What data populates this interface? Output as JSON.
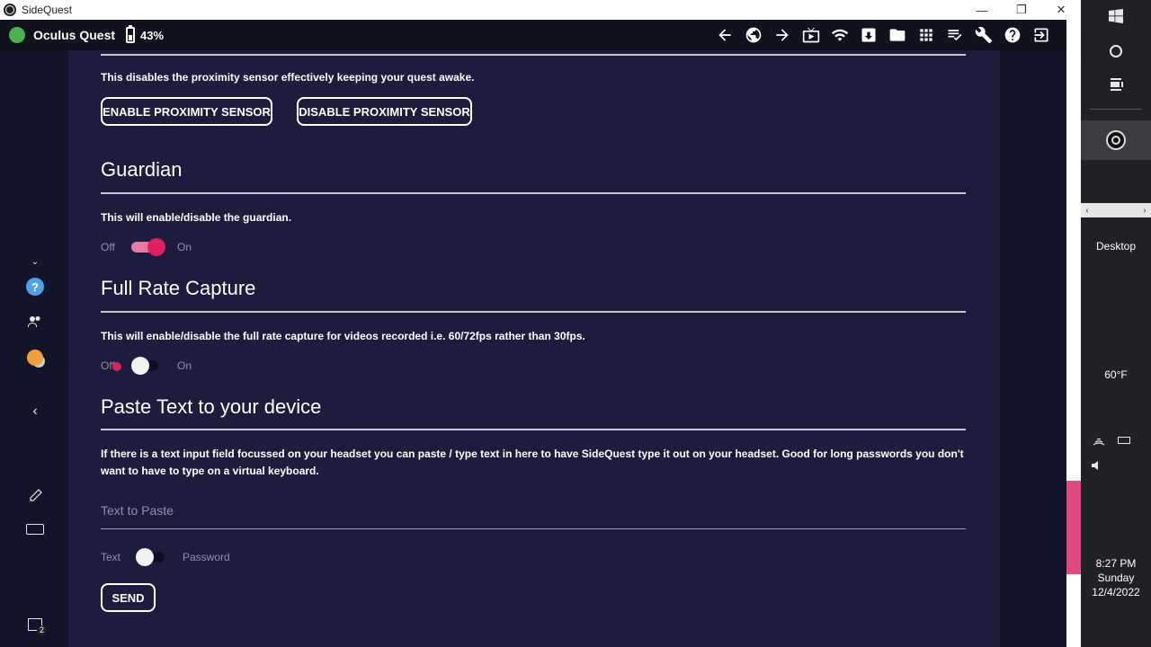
{
  "window": {
    "title": "SideQuest",
    "minimize": "—",
    "restore": "❐",
    "close": "✕"
  },
  "toolbar": {
    "device_name": "Oculus Quest",
    "battery": "43%",
    "status_color": "#4caf50",
    "icons": [
      "back-arrow-icon",
      "globe-icon",
      "forward-arrow-icon",
      "media-icon",
      "wifi-icon",
      "download-box-icon",
      "folder-icon",
      "apps-grid-icon",
      "task-list-icon",
      "wrench-icon",
      "help-icon",
      "exit-icon"
    ]
  },
  "proximity": {
    "description": "This disables the proximity sensor effectively keeping your quest awake.",
    "enable_label": "ENABLE PROXIMITY SENSOR",
    "disable_label": "DISABLE PROXIMITY SENSOR"
  },
  "guardian": {
    "heading": "Guardian",
    "description": "This will enable/disable the guardian.",
    "off_label": "Off",
    "on_label": "On",
    "enabled": true
  },
  "full_rate": {
    "heading": "Full Rate Capture",
    "description": "This will enable/disable the full rate capture for videos recorded i.e. 60/72fps rather than 30fps.",
    "off_label": "Off",
    "on_label": "On",
    "enabled": false
  },
  "paste": {
    "heading": "Paste Text to your device",
    "description_line1": "If there is a text input field focussed on your headset you can paste / type text in here to have SideQuest type it out on your headset. Good for long passwords you don't",
    "description_line2": "want to have to type on a virtual keyboard.",
    "placeholder": "Text to Paste",
    "text_label": "Text",
    "password_label": "Password",
    "password_mode": false,
    "send_label": "SEND"
  },
  "colors": {
    "accent": "#e0205e",
    "background": "#1c1d3d"
  },
  "taskbar": {
    "desktop_label": "Desktop",
    "temperature": "60°F",
    "time": "8:27 PM",
    "day": "Sunday",
    "date": "12/4/2022",
    "notification_count": "2"
  }
}
